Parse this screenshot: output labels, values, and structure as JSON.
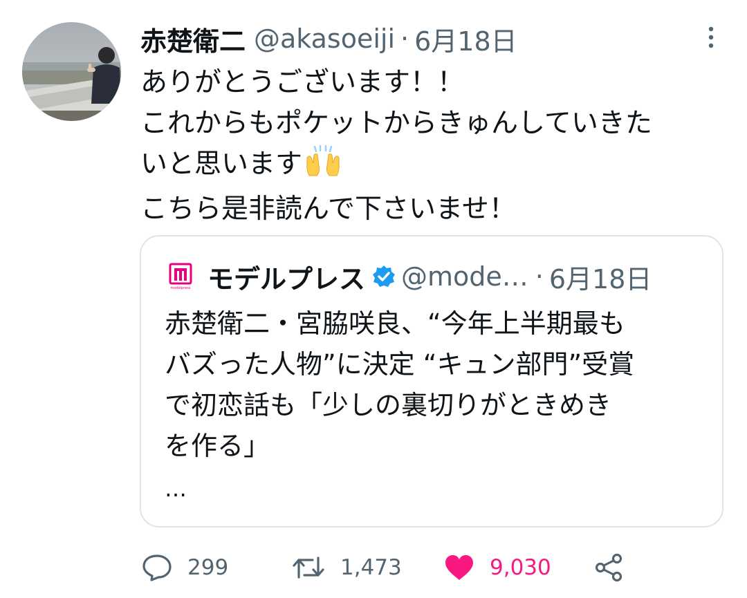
{
  "author": {
    "display_name": "赤楚衛二",
    "handle": "@akasoeiji",
    "separator": "·",
    "date": "6月18日"
  },
  "tweet": {
    "lines": [
      "ありがとうございます！！",
      "これからもポケットからきゅんしていきた",
      "いと思います",
      "こちら是非読んで下さいませ！"
    ],
    "emoji": "raising-hands-emoji"
  },
  "quoted_tweet": {
    "logo_text": "modelpress",
    "display_name": "モデルプレス",
    "verified": true,
    "handle": "@mode…",
    "separator": "·",
    "date": "6月18日",
    "lines": [
      "赤楚衛二・宮脇咲良、“今年上半期最も",
      "バズった人物”に決定 “キュン部門”受賞",
      "で初恋話も「少しの裏切りがときめき",
      "を作る」"
    ],
    "ellipsis": "…"
  },
  "actions": {
    "reply_count": "299",
    "retweet_count": "1,473",
    "like_count": "9,030"
  },
  "colors": {
    "text": "#0f1419",
    "secondary": "#536471",
    "like": "#f91880",
    "verified": "#1d9bf0",
    "border": "#dfe3e8",
    "modelpress_brand": "#e4007f"
  }
}
